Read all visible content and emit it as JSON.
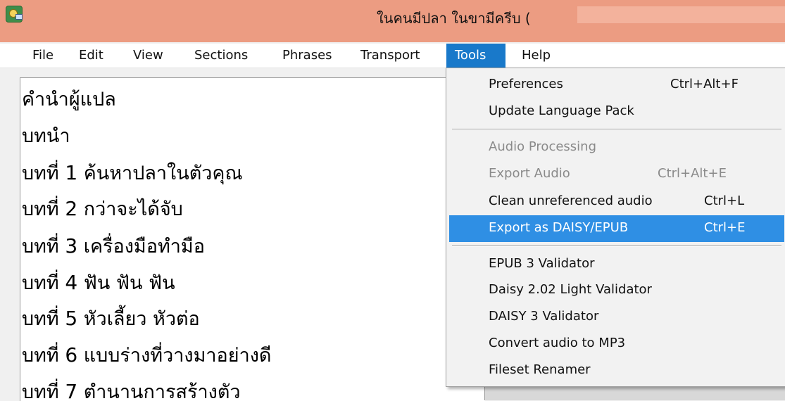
{
  "window": {
    "title": "ในคนมีปลา ในขามีครีบ ("
  },
  "menubar": {
    "items": [
      {
        "label": "File"
      },
      {
        "label": "Edit"
      },
      {
        "label": "View"
      },
      {
        "label": "Sections"
      },
      {
        "label": "Phrases"
      },
      {
        "label": "Transport"
      },
      {
        "label": "Tools"
      },
      {
        "label": "Help"
      }
    ]
  },
  "sections": [
    {
      "pre": "คำนำผู้แปล",
      "num": "",
      "post": ""
    },
    {
      "pre": "บทนำ",
      "num": "",
      "post": ""
    },
    {
      "pre": "บทที่ ",
      "num": "1",
      "post": " ค้นหาปลาในตัวคุณ"
    },
    {
      "pre": "บทที่ ",
      "num": "2",
      "post": " กว่าจะได้จับ"
    },
    {
      "pre": "บทที่ ",
      "num": "3",
      "post": " เครื่องมือทำมือ"
    },
    {
      "pre": "บทที่ ",
      "num": "4",
      "post": " ฟัน ฟัน ฟัน"
    },
    {
      "pre": "บทที่ ",
      "num": "5",
      "post": " หัวเลี้ยว หัวต่อ"
    },
    {
      "pre": "บทที่ ",
      "num": "6",
      "post": " แบบร่างที่วางมาอย่างดี"
    },
    {
      "pre": "บทที่ ",
      "num": "7",
      "post": " ตำนานการสร้างตัว"
    }
  ],
  "tools_menu": {
    "items": [
      {
        "label": "Preferences",
        "shortcut": "Ctrl+Alt+F",
        "state": "enabled"
      },
      {
        "label": "Update Language Pack",
        "shortcut": "",
        "state": "enabled"
      },
      {
        "label": "Audio Processing",
        "shortcut": "",
        "state": "disabled"
      },
      {
        "label": "Export Audio",
        "shortcut": "Ctrl+Alt+E",
        "state": "disabled"
      },
      {
        "label": "Clean unreferenced audio",
        "shortcut": "Ctrl+L",
        "state": "enabled"
      },
      {
        "label": "Export as DAISY/EPUB",
        "shortcut": "Ctrl+E",
        "state": "highlighted"
      },
      {
        "label": "EPUB 3 Validator",
        "shortcut": "",
        "state": "enabled"
      },
      {
        "label": "Daisy 2.02 Light Validator",
        "shortcut": "",
        "state": "enabled"
      },
      {
        "label": "DAISY 3 Validator",
        "shortcut": "",
        "state": "enabled"
      },
      {
        "label": "Convert audio to MP3",
        "shortcut": "",
        "state": "enabled"
      },
      {
        "label": "Fileset Renamer",
        "shortcut": "",
        "state": "enabled"
      }
    ]
  },
  "colors": {
    "titlebar": "#ec9c82",
    "menu_active": "#1979ca",
    "highlight": "#2f8fe4"
  },
  "icons": {
    "app": "app-icon"
  }
}
